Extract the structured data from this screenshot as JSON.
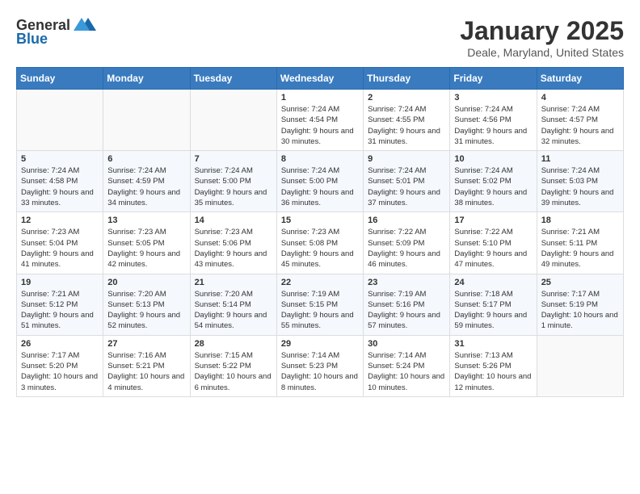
{
  "header": {
    "logo_general": "General",
    "logo_blue": "Blue",
    "title": "January 2025",
    "subtitle": "Deale, Maryland, United States"
  },
  "weekdays": [
    "Sunday",
    "Monday",
    "Tuesday",
    "Wednesday",
    "Thursday",
    "Friday",
    "Saturday"
  ],
  "weeks": [
    [
      {
        "day": "",
        "sunrise": "",
        "sunset": "",
        "daylight": ""
      },
      {
        "day": "",
        "sunrise": "",
        "sunset": "",
        "daylight": ""
      },
      {
        "day": "",
        "sunrise": "",
        "sunset": "",
        "daylight": ""
      },
      {
        "day": "1",
        "sunrise": "Sunrise: 7:24 AM",
        "sunset": "Sunset: 4:54 PM",
        "daylight": "Daylight: 9 hours and 30 minutes."
      },
      {
        "day": "2",
        "sunrise": "Sunrise: 7:24 AM",
        "sunset": "Sunset: 4:55 PM",
        "daylight": "Daylight: 9 hours and 31 minutes."
      },
      {
        "day": "3",
        "sunrise": "Sunrise: 7:24 AM",
        "sunset": "Sunset: 4:56 PM",
        "daylight": "Daylight: 9 hours and 31 minutes."
      },
      {
        "day": "4",
        "sunrise": "Sunrise: 7:24 AM",
        "sunset": "Sunset: 4:57 PM",
        "daylight": "Daylight: 9 hours and 32 minutes."
      }
    ],
    [
      {
        "day": "5",
        "sunrise": "Sunrise: 7:24 AM",
        "sunset": "Sunset: 4:58 PM",
        "daylight": "Daylight: 9 hours and 33 minutes."
      },
      {
        "day": "6",
        "sunrise": "Sunrise: 7:24 AM",
        "sunset": "Sunset: 4:59 PM",
        "daylight": "Daylight: 9 hours and 34 minutes."
      },
      {
        "day": "7",
        "sunrise": "Sunrise: 7:24 AM",
        "sunset": "Sunset: 5:00 PM",
        "daylight": "Daylight: 9 hours and 35 minutes."
      },
      {
        "day": "8",
        "sunrise": "Sunrise: 7:24 AM",
        "sunset": "Sunset: 5:00 PM",
        "daylight": "Daylight: 9 hours and 36 minutes."
      },
      {
        "day": "9",
        "sunrise": "Sunrise: 7:24 AM",
        "sunset": "Sunset: 5:01 PM",
        "daylight": "Daylight: 9 hours and 37 minutes."
      },
      {
        "day": "10",
        "sunrise": "Sunrise: 7:24 AM",
        "sunset": "Sunset: 5:02 PM",
        "daylight": "Daylight: 9 hours and 38 minutes."
      },
      {
        "day": "11",
        "sunrise": "Sunrise: 7:24 AM",
        "sunset": "Sunset: 5:03 PM",
        "daylight": "Daylight: 9 hours and 39 minutes."
      }
    ],
    [
      {
        "day": "12",
        "sunrise": "Sunrise: 7:23 AM",
        "sunset": "Sunset: 5:04 PM",
        "daylight": "Daylight: 9 hours and 41 minutes."
      },
      {
        "day": "13",
        "sunrise": "Sunrise: 7:23 AM",
        "sunset": "Sunset: 5:05 PM",
        "daylight": "Daylight: 9 hours and 42 minutes."
      },
      {
        "day": "14",
        "sunrise": "Sunrise: 7:23 AM",
        "sunset": "Sunset: 5:06 PM",
        "daylight": "Daylight: 9 hours and 43 minutes."
      },
      {
        "day": "15",
        "sunrise": "Sunrise: 7:23 AM",
        "sunset": "Sunset: 5:08 PM",
        "daylight": "Daylight: 9 hours and 45 minutes."
      },
      {
        "day": "16",
        "sunrise": "Sunrise: 7:22 AM",
        "sunset": "Sunset: 5:09 PM",
        "daylight": "Daylight: 9 hours and 46 minutes."
      },
      {
        "day": "17",
        "sunrise": "Sunrise: 7:22 AM",
        "sunset": "Sunset: 5:10 PM",
        "daylight": "Daylight: 9 hours and 47 minutes."
      },
      {
        "day": "18",
        "sunrise": "Sunrise: 7:21 AM",
        "sunset": "Sunset: 5:11 PM",
        "daylight": "Daylight: 9 hours and 49 minutes."
      }
    ],
    [
      {
        "day": "19",
        "sunrise": "Sunrise: 7:21 AM",
        "sunset": "Sunset: 5:12 PM",
        "daylight": "Daylight: 9 hours and 51 minutes."
      },
      {
        "day": "20",
        "sunrise": "Sunrise: 7:20 AM",
        "sunset": "Sunset: 5:13 PM",
        "daylight": "Daylight: 9 hours and 52 minutes."
      },
      {
        "day": "21",
        "sunrise": "Sunrise: 7:20 AM",
        "sunset": "Sunset: 5:14 PM",
        "daylight": "Daylight: 9 hours and 54 minutes."
      },
      {
        "day": "22",
        "sunrise": "Sunrise: 7:19 AM",
        "sunset": "Sunset: 5:15 PM",
        "daylight": "Daylight: 9 hours and 55 minutes."
      },
      {
        "day": "23",
        "sunrise": "Sunrise: 7:19 AM",
        "sunset": "Sunset: 5:16 PM",
        "daylight": "Daylight: 9 hours and 57 minutes."
      },
      {
        "day": "24",
        "sunrise": "Sunrise: 7:18 AM",
        "sunset": "Sunset: 5:17 PM",
        "daylight": "Daylight: 9 hours and 59 minutes."
      },
      {
        "day": "25",
        "sunrise": "Sunrise: 7:17 AM",
        "sunset": "Sunset: 5:19 PM",
        "daylight": "Daylight: 10 hours and 1 minute."
      }
    ],
    [
      {
        "day": "26",
        "sunrise": "Sunrise: 7:17 AM",
        "sunset": "Sunset: 5:20 PM",
        "daylight": "Daylight: 10 hours and 3 minutes."
      },
      {
        "day": "27",
        "sunrise": "Sunrise: 7:16 AM",
        "sunset": "Sunset: 5:21 PM",
        "daylight": "Daylight: 10 hours and 4 minutes."
      },
      {
        "day": "28",
        "sunrise": "Sunrise: 7:15 AM",
        "sunset": "Sunset: 5:22 PM",
        "daylight": "Daylight: 10 hours and 6 minutes."
      },
      {
        "day": "29",
        "sunrise": "Sunrise: 7:14 AM",
        "sunset": "Sunset: 5:23 PM",
        "daylight": "Daylight: 10 hours and 8 minutes."
      },
      {
        "day": "30",
        "sunrise": "Sunrise: 7:14 AM",
        "sunset": "Sunset: 5:24 PM",
        "daylight": "Daylight: 10 hours and 10 minutes."
      },
      {
        "day": "31",
        "sunrise": "Sunrise: 7:13 AM",
        "sunset": "Sunset: 5:26 PM",
        "daylight": "Daylight: 10 hours and 12 minutes."
      },
      {
        "day": "",
        "sunrise": "",
        "sunset": "",
        "daylight": ""
      }
    ]
  ]
}
